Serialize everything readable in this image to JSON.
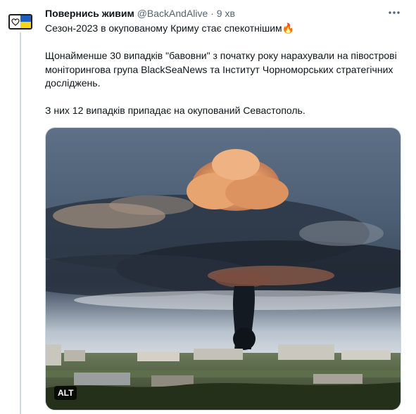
{
  "tweet": {
    "display_name": "Повернись живим",
    "handle": "@BackAndAlive",
    "separator": "·",
    "time": "9 хв",
    "text": {
      "line1": "Сезон-2023 в окупованому Криму стає спекотнішим🔥",
      "para2": "Щонайменше 30 випадків \"бавовни\" з початку року нарахували на півострові моніторингова група BlackSeaNews та Інститут Чорноморських стратегічних досліджень.",
      "para3": "З них 12 випадків припадає на окупований Севастополь."
    },
    "media": {
      "alt_badge": "ALT"
    }
  },
  "icons": {
    "avatar": "heart-flag-logo",
    "more": "more-horizontal-icon"
  },
  "colors": {
    "text_primary": "#0f1419",
    "text_secondary": "#536471",
    "thread_line": "#cfd9de",
    "flag_blue": "#1e5fbf",
    "flag_yellow": "#f7d417"
  }
}
